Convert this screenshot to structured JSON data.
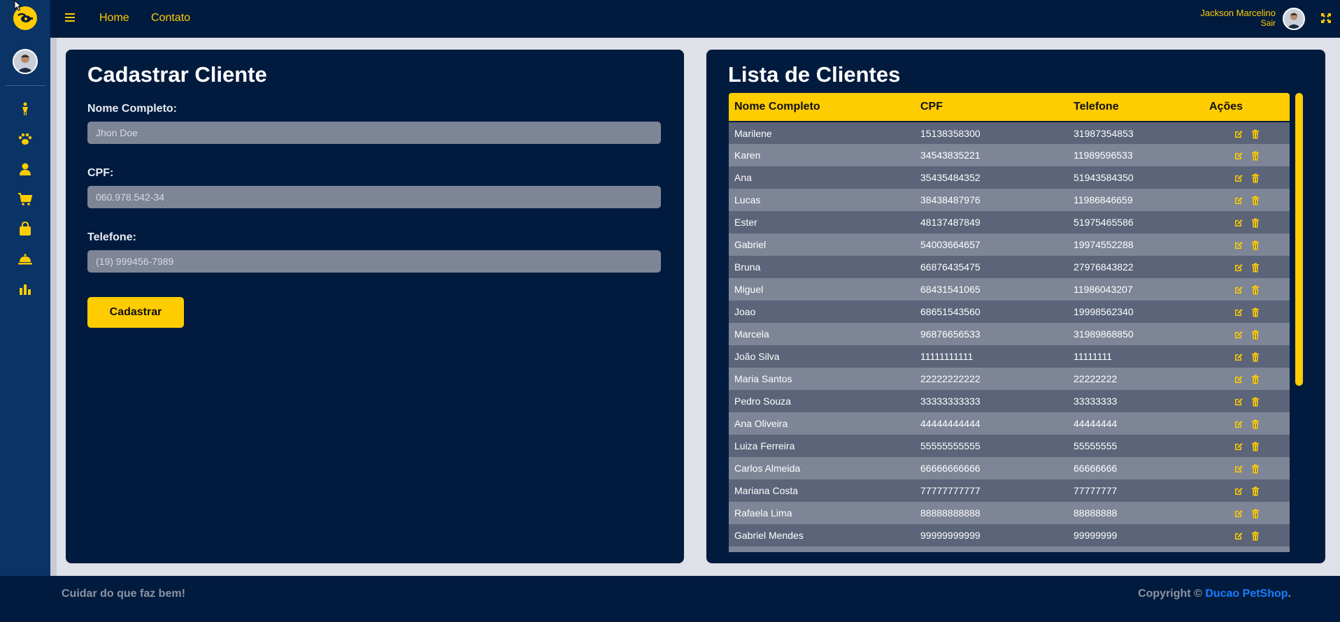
{
  "nav": {
    "home": "Home",
    "contact": "Contato",
    "user_name": "Jackson Marcelino",
    "logout": "Sair"
  },
  "form": {
    "title": "Cadastrar Cliente",
    "name_label": "Nome Completo:",
    "name_placeholder": "Jhon Doe",
    "cpf_label": "CPF:",
    "cpf_placeholder": "060.978.542-34",
    "phone_label": "Telefone:",
    "phone_placeholder": "(19) 999456-7989",
    "submit": "Cadastrar"
  },
  "list": {
    "title": "Lista de Clientes",
    "columns": [
      "Nome Completo",
      "CPF",
      "Telefone",
      "Ações"
    ],
    "rows": [
      {
        "name": "Marilene",
        "cpf": "15138358300",
        "phone": "31987354853"
      },
      {
        "name": "Karen",
        "cpf": "34543835221",
        "phone": "11989596533"
      },
      {
        "name": "Ana",
        "cpf": "35435484352",
        "phone": "51943584350"
      },
      {
        "name": "Lucas",
        "cpf": "38438487976",
        "phone": "11986846659"
      },
      {
        "name": "Ester",
        "cpf": "48137487849",
        "phone": "51975465586"
      },
      {
        "name": "Gabriel",
        "cpf": "54003664657",
        "phone": "19974552288"
      },
      {
        "name": "Bruna",
        "cpf": "66876435475",
        "phone": "27976843822"
      },
      {
        "name": "Miguel",
        "cpf": "68431541065",
        "phone": "11986043207"
      },
      {
        "name": "Joao",
        "cpf": "68651543560",
        "phone": "19998562340"
      },
      {
        "name": "Marcela",
        "cpf": "96876656533",
        "phone": "31989868850"
      },
      {
        "name": "João Silva",
        "cpf": "11111111111",
        "phone": "11111111"
      },
      {
        "name": "Maria Santos",
        "cpf": "22222222222",
        "phone": "22222222"
      },
      {
        "name": "Pedro Souza",
        "cpf": "33333333333",
        "phone": "33333333"
      },
      {
        "name": "Ana Oliveira",
        "cpf": "44444444444",
        "phone": "44444444"
      },
      {
        "name": "Luiza Ferreira",
        "cpf": "55555555555",
        "phone": "55555555"
      },
      {
        "name": "Carlos Almeida",
        "cpf": "66666666666",
        "phone": "66666666"
      },
      {
        "name": "Mariana Costa",
        "cpf": "77777777777",
        "phone": "77777777"
      },
      {
        "name": "Rafaela Lima",
        "cpf": "88888888888",
        "phone": "88888888"
      },
      {
        "name": "Gabriel Mendes",
        "cpf": "99999999999",
        "phone": "99999999"
      },
      {
        "name": "",
        "cpf": "",
        "phone": ""
      }
    ]
  },
  "footer": {
    "tagline": "Cuidar do que faz bem!",
    "copyright": "Copyright ©",
    "brand": "Ducao PetShop",
    "period": "."
  },
  "sidebar_icons": [
    "person-icon",
    "paw-icon",
    "user-icon",
    "cart-icon",
    "bag-icon",
    "service-bell-icon",
    "chart-icon"
  ],
  "colors": {
    "accent": "#ffcc00",
    "navy": "#011b3e",
    "sidebar": "#0a3366",
    "row_dark": "#5b6479",
    "row_light": "#7e8596",
    "link_blue": "#1a7cff"
  }
}
